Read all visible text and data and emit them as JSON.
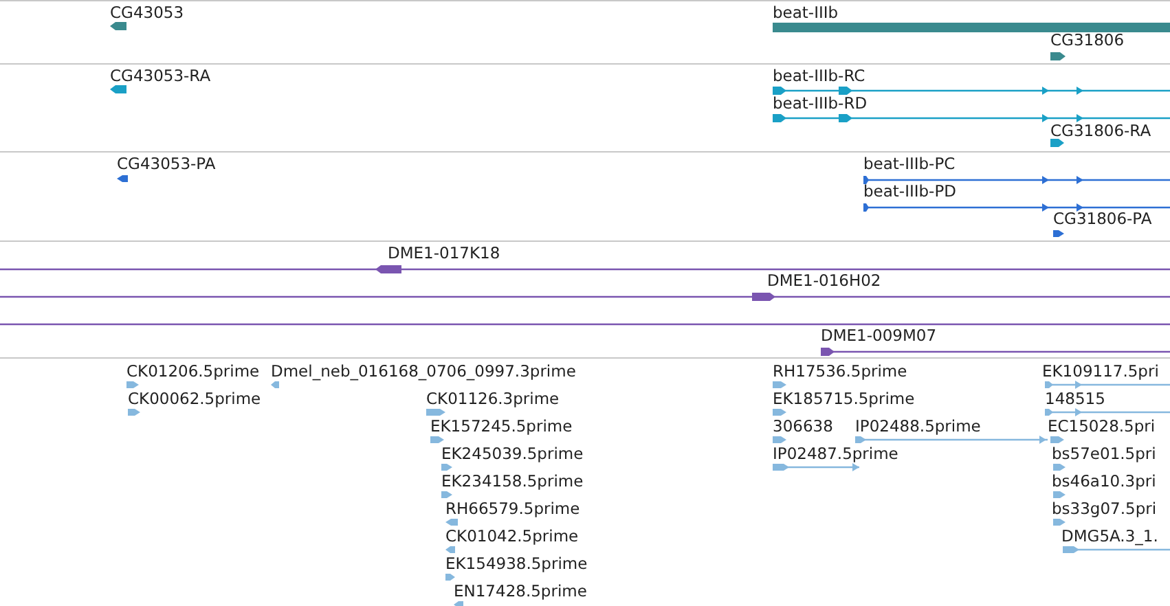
{
  "tracks": [
    {
      "kind": "gene",
      "features": [
        {
          "label": "CG43053",
          "reverse": true
        },
        {
          "label": "beat-IIIb"
        },
        {
          "label": "CG31806",
          "reverse": false
        }
      ]
    },
    {
      "kind": "transcript",
      "features": [
        {
          "label": "CG43053-RA",
          "reverse": true
        },
        {
          "label": "beat-IIIb-RC",
          "reverse": false
        },
        {
          "label": "beat-IIIb-RD",
          "reverse": false
        },
        {
          "label": "CG31806-RA",
          "reverse": false
        }
      ]
    },
    {
      "kind": "protein",
      "features": [
        {
          "label": "CG43053-PA",
          "reverse": true
        },
        {
          "label": "beat-IIIb-PC",
          "reverse": false
        },
        {
          "label": "beat-IIIb-PD",
          "reverse": false
        },
        {
          "label": "CG31806-PA",
          "reverse": false
        }
      ]
    },
    {
      "kind": "clone",
      "features": [
        {
          "label": "DME1-017K18",
          "reverse": true
        },
        {
          "label": "DME1-016H02",
          "reverse": false
        },
        {
          "kind": "line"
        },
        {
          "label": "DME1-009M07",
          "reverse": false
        }
      ]
    },
    {
      "kind": "est",
      "features": [
        {
          "label": "CK01206.5prime",
          "reverse": false
        },
        {
          "label": "Dmel_neb_016168_0706_0997.3prime",
          "reverse": true
        },
        {
          "label": "CK00062.5prime",
          "reverse": false
        },
        {
          "label": "CK01126.3prime",
          "reverse": false
        },
        {
          "label": "EK157245.5prime",
          "reverse": false
        },
        {
          "label": "EK245039.5prime",
          "reverse": false
        },
        {
          "label": "EK234158.5prime",
          "reverse": false
        },
        {
          "label": "RH66579.5prime",
          "reverse": true
        },
        {
          "label": "CK01042.5prime",
          "reverse": true
        },
        {
          "label": "EK154938.5prime",
          "reverse": false
        },
        {
          "label": "EN17428.5prime",
          "reverse": true
        },
        {
          "label": "RH17536.5prime",
          "reverse": false
        },
        {
          "label": "EK185715.5prime",
          "reverse": false
        },
        {
          "label": "306638",
          "reverse": false
        },
        {
          "label": "IP02488.5prime",
          "reverse": false
        },
        {
          "label": "IP02487.5prime",
          "reverse": false
        },
        {
          "label": "EK109117.5pri",
          "reverse": false
        },
        {
          "label": "148515",
          "reverse": false
        },
        {
          "label": "EC15028.5pri",
          "reverse": false
        },
        {
          "label": "bs57e01.5pri",
          "reverse": false
        },
        {
          "label": "bs46a10.3pri",
          "reverse": false
        },
        {
          "label": "bs33g07.5pri",
          "reverse": false
        },
        {
          "label": "DMG5A.3_1.",
          "reverse": false
        }
      ]
    }
  ]
}
